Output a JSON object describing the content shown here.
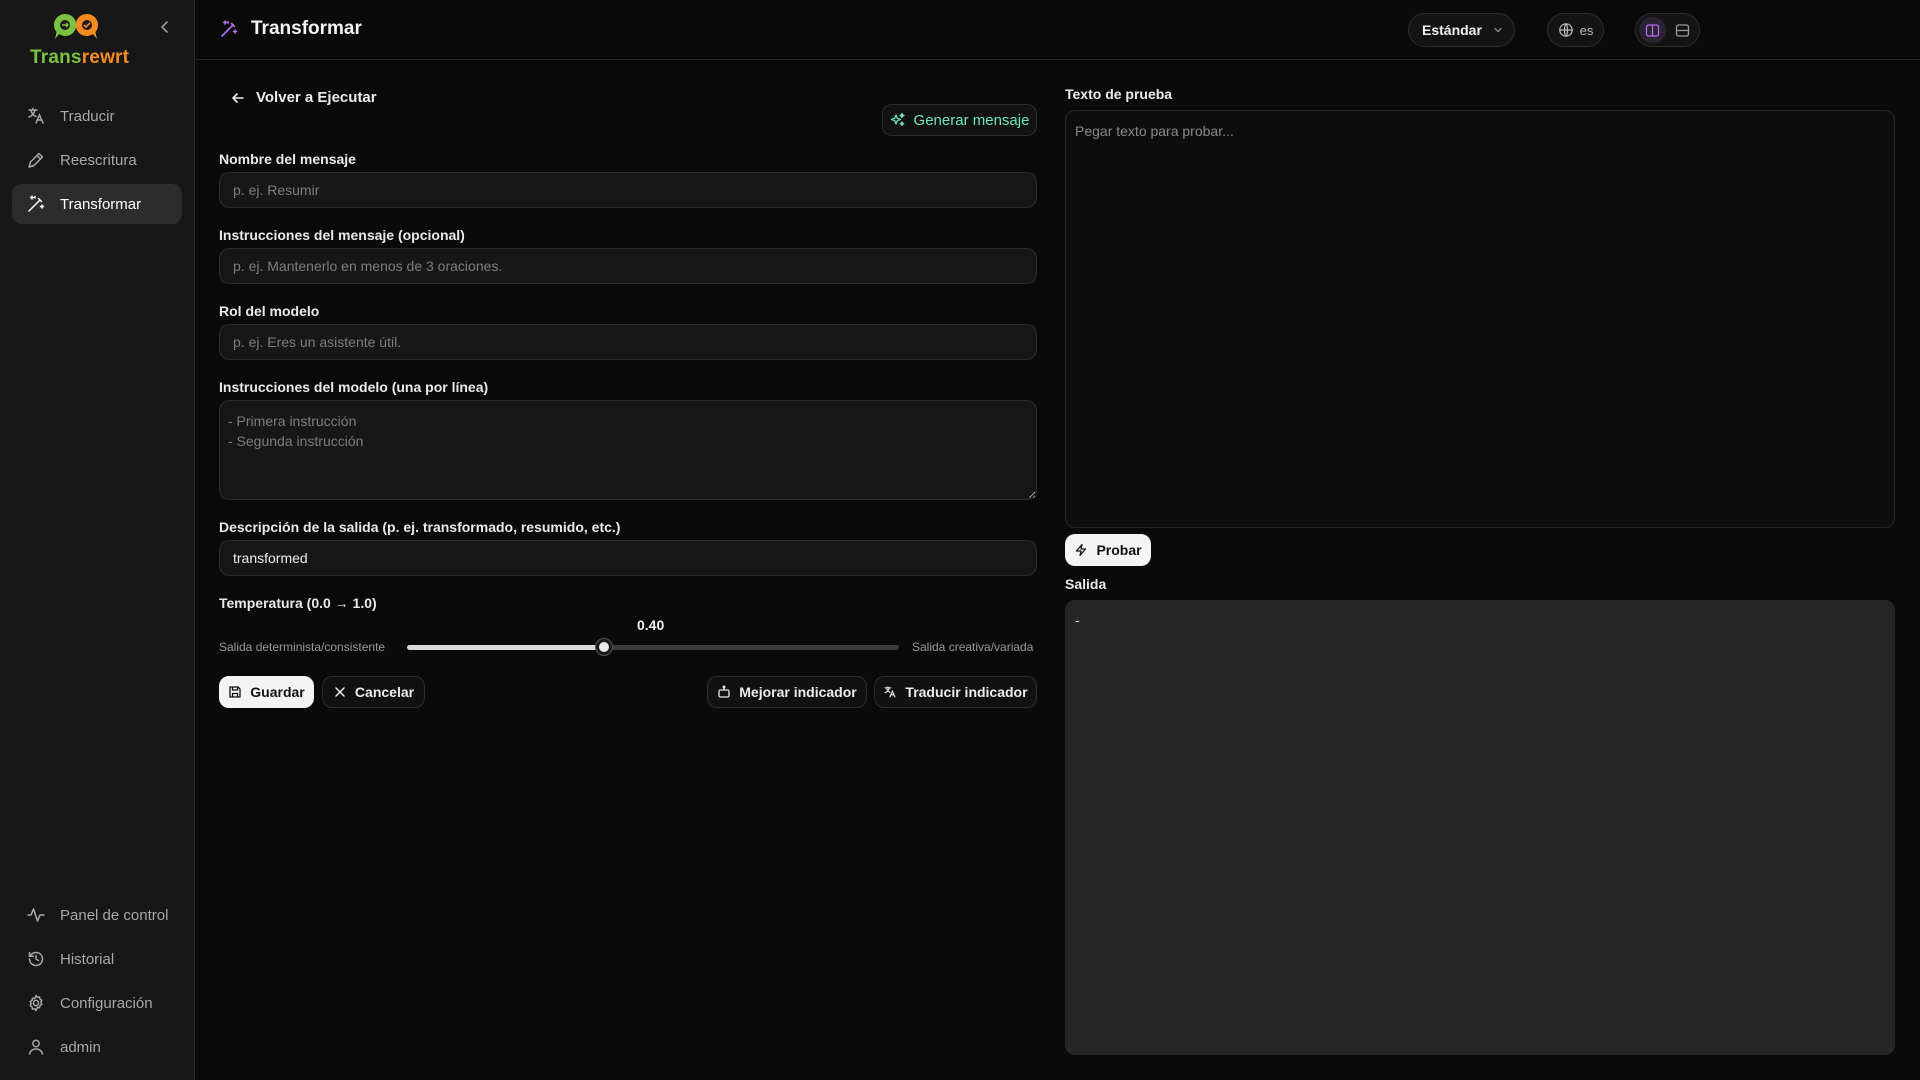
{
  "app": {
    "name_part1": "Trans",
    "name_part2": "rewrt",
    "brand_green": "#7cc242",
    "brand_orange": "#f58a1f"
  },
  "sidebar": {
    "top_items": [
      {
        "label": "Traducir",
        "icon": "translate-icon"
      },
      {
        "label": "Reescritura",
        "icon": "pen-icon"
      },
      {
        "label": "Transformar",
        "icon": "magic-wand-icon",
        "active": true
      }
    ],
    "bottom_items": [
      {
        "label": "Panel de control",
        "icon": "activity-icon"
      },
      {
        "label": "Historial",
        "icon": "history-icon"
      },
      {
        "label": "Configuración",
        "icon": "gear-icon"
      },
      {
        "label": "admin",
        "icon": "user-icon"
      }
    ]
  },
  "header": {
    "title": "Transformar",
    "mode": "Estándar",
    "language": "es",
    "layout_active": "split-columns"
  },
  "form": {
    "back_label": "Volver a Ejecutar",
    "generate_label": "Generar mensaje",
    "name": {
      "label": "Nombre del mensaje",
      "placeholder": "p. ej. Resumir",
      "value": ""
    },
    "instructions": {
      "label": "Instrucciones del mensaje (opcional)",
      "placeholder": "p. ej. Mantenerlo en menos de 3 oraciones.",
      "value": ""
    },
    "role": {
      "label": "Rol del modelo",
      "placeholder": "p. ej. Eres un asistente útil.",
      "value": ""
    },
    "model_instructions": {
      "label": "Instrucciones del modelo (una por línea)",
      "placeholder": "- Primera instrucción\n- Segunda instrucción",
      "value": ""
    },
    "output_desc": {
      "label": "Descripción de la salida (p. ej. transformado, resumido, etc.)",
      "value": "transformed"
    },
    "temperature": {
      "label": "Temperatura (0.0 → 1.0)",
      "value": 0.4,
      "display": "0.40",
      "min_label": "Salida determinista/consistente",
      "max_label": "Salida creativa/variada"
    },
    "buttons": {
      "save": "Guardar",
      "cancel": "Cancelar",
      "improve": "Mejorar indicador",
      "translate": "Traducir indicador"
    }
  },
  "test_panel": {
    "input_label": "Texto de prueba",
    "input_placeholder": "Pegar texto para probar...",
    "run_label": "Probar",
    "output_label": "Salida",
    "output_value": "-"
  }
}
